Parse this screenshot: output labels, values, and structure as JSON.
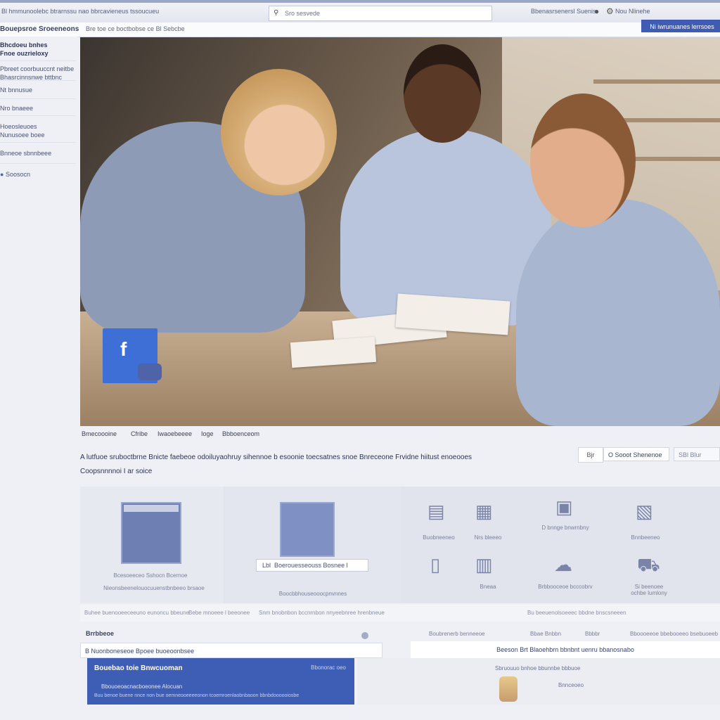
{
  "browser": {
    "window_title": "Bl  hmmunoolebc btrarnssu nao bbrcavieneus tssoucueu",
    "url": "Sro sesvede",
    "account_text": "Bbenasrsenersl Suenis",
    "account_trail": "Nou Nlinehe",
    "icon_globe": "globe-icon",
    "icon_settings": "gear-icon"
  },
  "subnav": {
    "brand": "Bouepsroe Sroeeneons",
    "breadcrumbs": "Bre toe ce boctbobse ce  Bl  Sebcbe",
    "action_button": "Ni iwrunuanes lerrsoes bnrvbe"
  },
  "sidebar": {
    "items": [
      {
        "label": "Bhcdoeu bnhes"
      },
      {
        "label": "Fnoe ouzrieloxy"
      },
      {
        "label": "Pbreet coorbuuccnt neitbe"
      },
      {
        "label": "Bhasrcinnsnwe bttbnc"
      },
      {
        "label": "Nt bnnusue"
      },
      {
        "label": "Nro bnaeee"
      },
      {
        "label": "Hoeosleuoes"
      },
      {
        "label": "Nunusoee boee"
      },
      {
        "label": "Bnneoe sbnnbeee"
      },
      {
        "label": "Soosocn"
      }
    ]
  },
  "hero": {
    "logo_glyph": "f",
    "logo_icon": "facebook-logo-icon"
  },
  "tabs": [
    "Bmecoooine",
    "Cfribe",
    "Iwaoebeeee",
    "Ioge",
    "Bbboenceom"
  ],
  "description": {
    "line1": "A lutfuoe sruboctbrne Bnicte faebeoe odoiluyaohruy sihennoe b esoonie toecsatnes snoe Bnreceone Frvidne hiitust enoeooes",
    "line2": "Coopsnnnnoi I ar soice"
  },
  "controls": {
    "small": "Bjr",
    "main": "O Sooot Shenenoe",
    "side": "SBl Blur"
  },
  "features": {
    "card1_caption": "Bcesoeeceo Sshocn Bcernoe",
    "card1_sub": "Nieonsbeenelouocuuenstbnbeeo brsaoe",
    "search_value": "Lbl  Boerouesseouss Bosnee l",
    "card2_caption": "Boocbbhouseooocpnvnnes",
    "items": [
      {
        "icon": "document-icon",
        "label": "Buobneeneo"
      },
      {
        "icon": "layout-icon",
        "label": "Nrs bleeeo"
      },
      {
        "icon": "window-icon",
        "label": "D bnnge bnwrnbny"
      },
      {
        "icon": "chart-icon",
        "label": "Bnnbeeneo"
      },
      {
        "icon": "phone-icon",
        "label": ""
      },
      {
        "icon": "file-icon",
        "label": "Bneaa"
      },
      {
        "icon": "cloud-icon",
        "label": "Brbbooceoe bcccobrv"
      },
      {
        "icon": "tray-icon",
        "label": "Si beenoee\nochbe lumlony"
      }
    ]
  },
  "strip": {
    "a": "Buhee buenooeeceeuno eunoncu bbeune",
    "b": "Bebe mnoeee l beeonee",
    "c": "Snm bnobnbon bccnrnbon nnyeebnree hrenbneue",
    "d": "Bu beeuenolsoeeec bbdne bnscsneeen"
  },
  "list": {
    "header": "Brrbbeoe",
    "header_right_a": "Boubrenerb benneeoe",
    "header_right_b": "Bbae  Bnbbn",
    "header_right_c": "Bbbbr",
    "header_right_d": "Bboooeeoe bbebooeeo bsebuoeeb",
    "row_left": "B Nuonboneseoe Bpoee buoeoonbsee",
    "row_right": "Beeson Brt Blaoehbrn bbnbnt uenru bbanosnabo",
    "card_title": "Bouebao toie Bnwcuoman",
    "card_title_right": "Bbonorac oeo",
    "card_line1": "Bbouoeoacnacboeonee Alocuan",
    "card_line2": "Buu  benoe buene nnce non bue oemneooeeeeonon tcoemroenlaobnbaoon bbnbdoooooiosbe",
    "preview_title": "Sbruouuo bnhoe bbunnbe bbbuoe",
    "preview_line": "Bnnceoeo"
  },
  "colors": {
    "brand_blue": "#3e5eb5",
    "facebook_blue": "#3d6fd6",
    "page_bg": "#eef0f5"
  }
}
